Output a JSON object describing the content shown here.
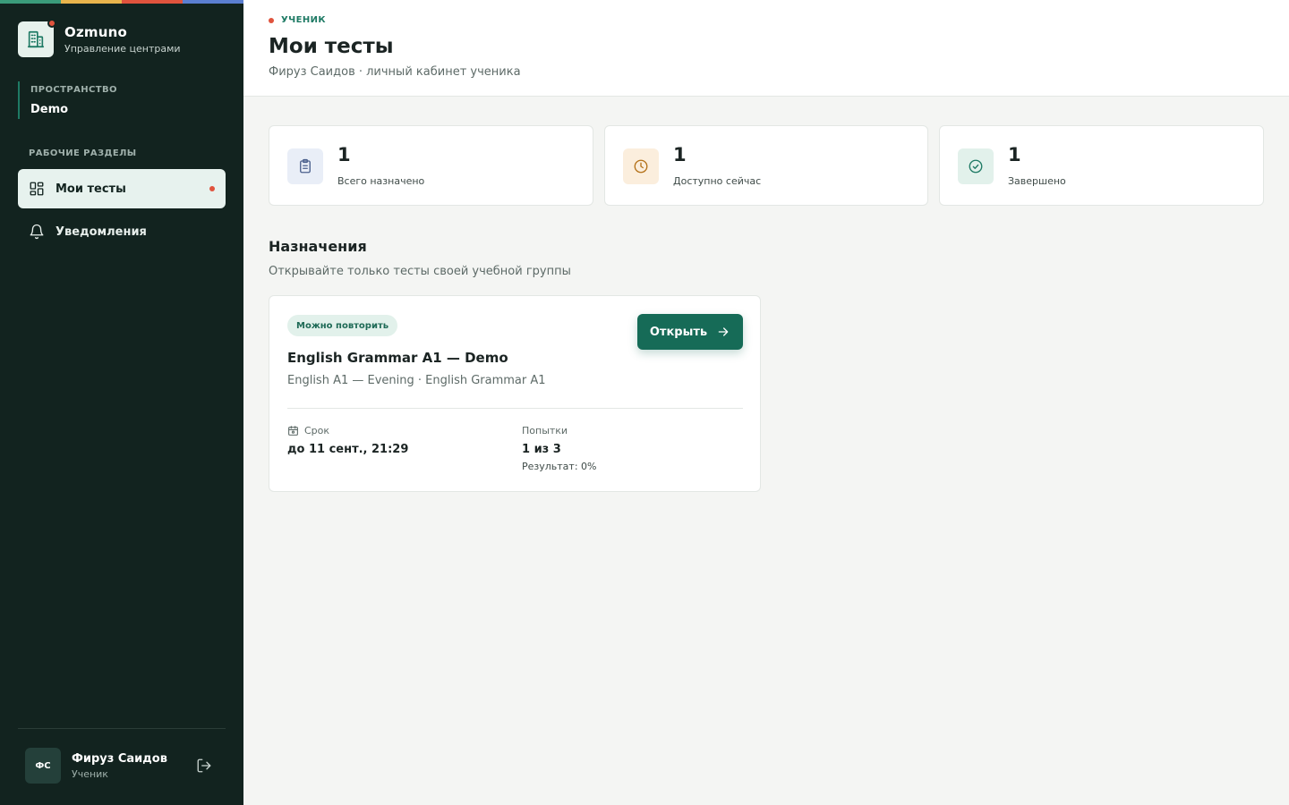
{
  "colors": {
    "sidebar_bg": "#12231f",
    "accent": "#166b57",
    "alert_dot": "#e0533d",
    "rainbow": [
      "#3a9b7a",
      "#e9b44c",
      "#e0533d",
      "#5b7fd1"
    ]
  },
  "brand": {
    "name": "Ozmuno",
    "subtitle": "Управление центрами",
    "icon": "building-icon"
  },
  "workspace": {
    "label": "ПРОСТРАНСТВО",
    "value": "Demo"
  },
  "nav": {
    "section_title": "РАБОЧИЕ РАЗДЕЛЫ",
    "items": [
      {
        "label": "Мои тесты",
        "icon": "grid-icon",
        "active": true,
        "has_dot": true
      },
      {
        "label": "Уведомления",
        "icon": "bell-icon",
        "active": false,
        "has_dot": false
      }
    ]
  },
  "user": {
    "initials": "ФС",
    "name": "Фируз Саидов",
    "role": "Ученик",
    "logout_icon": "logout-icon"
  },
  "header": {
    "eyebrow": "УЧЕНИК",
    "title": "Мои тесты",
    "subtitle": "Фируз Саидов · личный кабинет ученика"
  },
  "stats": [
    {
      "value": "1",
      "label": "Всего назначено",
      "icon": "clipboard-icon",
      "icon_bg": "#e9eef7",
      "icon_color": "#4a5f8c"
    },
    {
      "value": "1",
      "label": "Доступно сейчас",
      "icon": "clock-icon",
      "icon_bg": "#fbeedd",
      "icon_color": "#b4721a"
    },
    {
      "value": "1",
      "label": "Завершено",
      "icon": "check-circle-icon",
      "icon_bg": "#e2f1eb",
      "icon_color": "#1e7a64"
    }
  ],
  "assignments": {
    "title": "Назначения",
    "subtitle": "Открывайте только тесты своей учебной группы",
    "items": [
      {
        "badge": "Можно повторить",
        "title": "English Grammar A1 — Demo",
        "subtitle": "English A1 — Evening · English Grammar A1",
        "open_label": "Открыть",
        "deadline_label": "Срок",
        "deadline_value": "до 11 сент., 21:29",
        "attempts_label": "Попытки",
        "attempts_value": "1 из 3",
        "result": "Результат: 0%"
      }
    ]
  }
}
